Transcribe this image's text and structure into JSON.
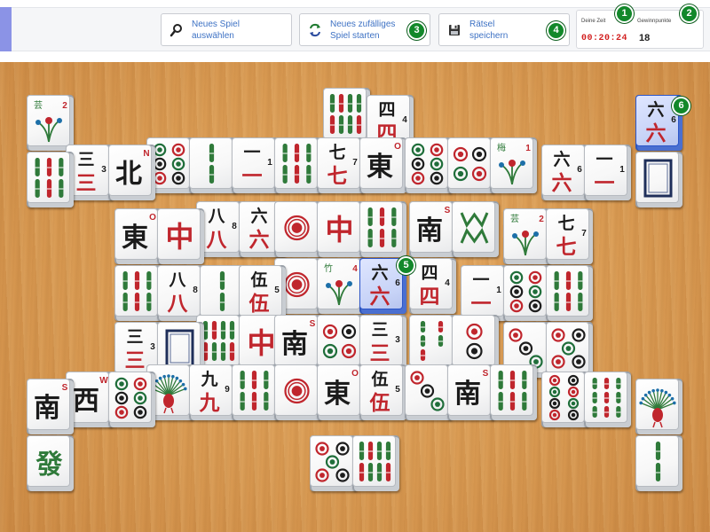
{
  "toolbar": {
    "select_game_label": "Neues Spiel\nauswählen",
    "random_game_label": "Neues zufälliges\nSpiel starten",
    "save_label": "Rätsel\nspeichern",
    "time_caption": "Deine Zeit",
    "time_value": "00:20:24",
    "score_caption": "Gewinnpunkte",
    "score_value": "18",
    "icons": {
      "select": "magnifier-icon",
      "random": "shuffle-icon",
      "save": "floppy-disk-icon"
    }
  },
  "callouts": [
    "1",
    "2",
    "3",
    "4",
    "5",
    "6"
  ],
  "colors": {
    "accent": "#8b93e6",
    "link": "#3e72c4",
    "timer": "#d21f1f",
    "badge": "#12882a",
    "board": "#d99a52",
    "selected": "#c7d3f7"
  },
  "tiles": [
    {
      "kind": "flower",
      "label": "芸",
      "num": "2",
      "selected": false
    },
    {
      "kind": "bamboo",
      "num": "6",
      "selected": false
    },
    {
      "kind": "bamboo",
      "num": "8",
      "selected": false
    },
    {
      "kind": "char",
      "label": "四",
      "num": "4",
      "selected": false
    },
    {
      "kind": "char",
      "label": "三",
      "num": "3",
      "selected": false
    },
    {
      "kind": "wind",
      "label": "北",
      "num": "N",
      "selected": false
    },
    {
      "kind": "dots",
      "num": "6",
      "selected": false
    },
    {
      "kind": "bamboo",
      "num": "2",
      "selected": false
    },
    {
      "kind": "char",
      "label": "一",
      "num": "1",
      "selected": false
    },
    {
      "kind": "bamboo",
      "num": "6",
      "selected": false
    },
    {
      "kind": "char",
      "label": "七",
      "num": "7",
      "selected": false
    },
    {
      "kind": "wind",
      "label": "東",
      "num": "O",
      "selected": false
    },
    {
      "kind": "dots",
      "num": "6",
      "selected": false
    },
    {
      "kind": "dots",
      "num": "4",
      "selected": false
    },
    {
      "kind": "flower",
      "label": "梅",
      "num": "1",
      "selected": false
    },
    {
      "kind": "char",
      "label": "六",
      "num": "6",
      "selected": false
    },
    {
      "kind": "char",
      "label": "一",
      "num": "1",
      "selected": false
    },
    {
      "kind": "char",
      "label": "六",
      "num": "6",
      "selected": true
    },
    {
      "kind": "white",
      "selected": false
    },
    {
      "kind": "wind",
      "label": "東",
      "num": "O",
      "selected": false
    },
    {
      "kind": "red",
      "label": "中",
      "selected": false
    },
    {
      "kind": "char",
      "label": "八",
      "num": "8",
      "selected": false
    },
    {
      "kind": "char",
      "label": "六",
      "num": "6",
      "selected": false
    },
    {
      "kind": "dots",
      "num": "1",
      "selected": false
    },
    {
      "kind": "red",
      "label": "中",
      "selected": false
    },
    {
      "kind": "bamboo",
      "num": "6",
      "selected": false
    },
    {
      "kind": "wind",
      "label": "南",
      "num": "S",
      "selected": false
    },
    {
      "kind": "bamboo",
      "num": "WM",
      "selected": false
    },
    {
      "kind": "flower",
      "label": "芸",
      "num": "2",
      "selected": false
    },
    {
      "kind": "char",
      "label": "七",
      "num": "7",
      "selected": false
    },
    {
      "kind": "bamboo",
      "num": "6",
      "selected": false
    },
    {
      "kind": "char",
      "label": "八",
      "num": "8",
      "selected": false
    },
    {
      "kind": "bamboo",
      "num": "2",
      "selected": false
    },
    {
      "kind": "char",
      "label": "伍",
      "num": "5",
      "selected": false
    },
    {
      "kind": "dots",
      "num": "1",
      "selected": false
    },
    {
      "kind": "flower",
      "label": "竹",
      "num": "4",
      "selected": false
    },
    {
      "kind": "char",
      "label": "六",
      "num": "6",
      "selected": true
    },
    {
      "kind": "char",
      "label": "四",
      "num": "4",
      "selected": false
    },
    {
      "kind": "char",
      "label": "一",
      "num": "1",
      "selected": false
    },
    {
      "kind": "dots",
      "num": "6",
      "selected": false
    },
    {
      "kind": "bamboo",
      "num": "6",
      "selected": false
    },
    {
      "kind": "char",
      "label": "三",
      "num": "3",
      "selected": false
    },
    {
      "kind": "white",
      "selected": false
    },
    {
      "kind": "bamboo",
      "num": "8",
      "selected": false
    },
    {
      "kind": "red",
      "label": "中",
      "selected": false
    },
    {
      "kind": "wind",
      "label": "南",
      "num": "S",
      "selected": false
    },
    {
      "kind": "dots",
      "num": "4",
      "selected": false
    },
    {
      "kind": "char",
      "label": "三",
      "num": "3",
      "selected": false
    },
    {
      "kind": "bamboo",
      "num": "5",
      "selected": false
    },
    {
      "kind": "dots",
      "num": "2",
      "selected": false
    },
    {
      "kind": "dots",
      "num": "3",
      "selected": false
    },
    {
      "kind": "dots",
      "num": "5",
      "selected": false
    },
    {
      "kind": "wind",
      "label": "南",
      "num": "S",
      "selected": false
    },
    {
      "kind": "wind",
      "label": "西",
      "num": "W",
      "selected": false
    },
    {
      "kind": "dots",
      "num": "6",
      "selected": false
    },
    {
      "kind": "bamboo",
      "num": "1",
      "selected": false
    },
    {
      "kind": "char",
      "label": "九",
      "num": "9",
      "selected": false
    },
    {
      "kind": "bamboo",
      "num": "6",
      "selected": false
    },
    {
      "kind": "dots",
      "num": "1",
      "selected": false
    },
    {
      "kind": "wind",
      "label": "東",
      "num": "O",
      "selected": false
    },
    {
      "kind": "char",
      "label": "伍",
      "num": "5",
      "selected": false
    },
    {
      "kind": "dots",
      "num": "3",
      "selected": false
    },
    {
      "kind": "wind",
      "label": "南",
      "num": "S",
      "selected": false
    },
    {
      "kind": "bamboo",
      "num": "6",
      "selected": false
    },
    {
      "kind": "dots",
      "num": "8",
      "selected": false
    },
    {
      "kind": "bamboo",
      "num": "9",
      "selected": false
    },
    {
      "kind": "bamboo",
      "num": "1",
      "selected": false
    },
    {
      "kind": "green",
      "label": "發",
      "selected": false
    },
    {
      "kind": "dots",
      "num": "5",
      "selected": false
    },
    {
      "kind": "bamboo",
      "num": "8",
      "selected": false
    },
    {
      "kind": "bamboo",
      "num": "2",
      "selected": false
    }
  ]
}
